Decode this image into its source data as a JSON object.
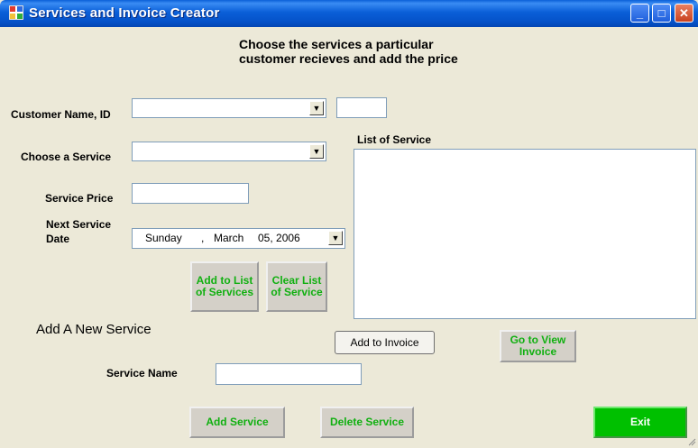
{
  "window": {
    "title": "Services and Invoice Creator",
    "icon": "app-window-icon",
    "controls": {
      "minimize": "_",
      "maximize": "□",
      "close": "✕"
    }
  },
  "heading": "Choose the services a particular customer recieves and add the price",
  "customer": {
    "label": "Customer Name, ID",
    "selected": "",
    "id_value": ""
  },
  "service": {
    "label": "Choose a Service",
    "selected": ""
  },
  "price": {
    "label": "Service Price",
    "value": ""
  },
  "next_date": {
    "label_line1": "Next Service",
    "label_line2": "Date",
    "weekday": "Sunday",
    "sep": ",",
    "month": "March",
    "dayyear": "05, 2006"
  },
  "list": {
    "label": "List of Service",
    "items": []
  },
  "buttons": {
    "add_to_list": "Add to List of Services",
    "clear_list": "Clear List of Service",
    "add_to_invoice": "Add to Invoice",
    "go_to_invoice": "Go to View Invoice",
    "add_service": "Add Service",
    "delete_service": "Delete Service",
    "exit": "Exit"
  },
  "new_service": {
    "heading": "Add A New Service",
    "name_label": "Service Name",
    "name_value": ""
  },
  "colors": {
    "title_bar": "#0a5fd8",
    "button_text": "#11b011",
    "exit_bg": "#00c000",
    "window_bg": "#ece9d8"
  }
}
